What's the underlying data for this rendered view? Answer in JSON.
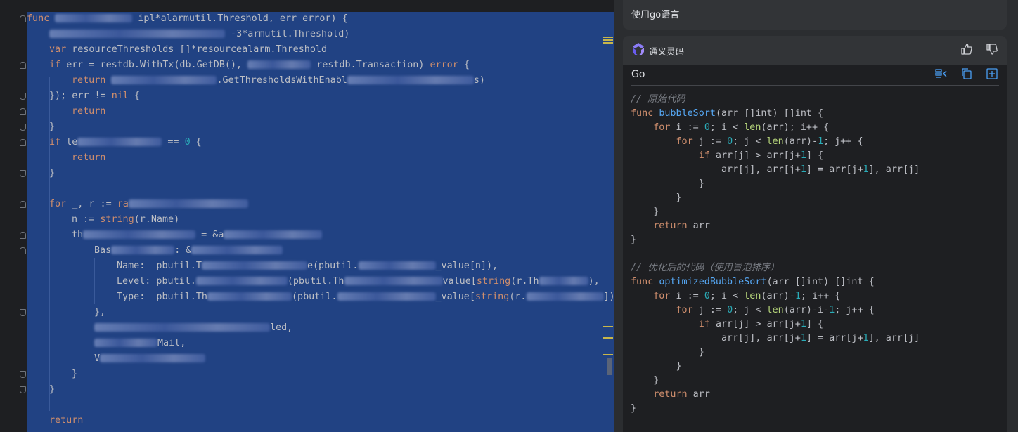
{
  "editor": {
    "lines": [
      {
        "indent": 0,
        "parts": [
          [
            "kw",
            "func "
          ],
          [
            "blur",
            ""
          ],
          [
            "t",
            " ipl*alarmutil.Threshold, err error) {"
          ]
        ]
      },
      {
        "indent": 1,
        "parts": [
          [
            "blur",
            ""
          ],
          [
            "t",
            " -3*armutil.Threshold)"
          ]
        ]
      },
      {
        "indent": 1,
        "parts": [
          [
            "kw",
            "var "
          ],
          [
            "t",
            "resourceThresholds []*resourcealarm.Threshold"
          ]
        ]
      },
      {
        "indent": 1,
        "parts": [
          [
            "kw",
            "if "
          ],
          [
            "t",
            "err = restdb.WithTx(db.GetDB(), "
          ],
          [
            "blur",
            ""
          ],
          [
            "t",
            " restdb.Transaction) "
          ],
          [
            "kw",
            "error"
          ],
          [
            "t",
            " {"
          ]
        ]
      },
      {
        "indent": 2,
        "parts": [
          [
            "kw",
            "return "
          ],
          [
            "blur",
            ""
          ],
          [
            "t",
            ".GetThresholdsWithEnabl"
          ],
          [
            "blur",
            ""
          ],
          [
            "t",
            "s)"
          ]
        ]
      },
      {
        "indent": 1,
        "parts": [
          [
            "t",
            "}); err != "
          ],
          [
            "kw",
            "nil"
          ],
          [
            "t",
            " {"
          ]
        ]
      },
      {
        "indent": 2,
        "parts": [
          [
            "kw",
            "return"
          ]
        ]
      },
      {
        "indent": 1,
        "parts": [
          [
            "t",
            "}"
          ]
        ]
      },
      {
        "indent": 1,
        "parts": [
          [
            "kw",
            "if "
          ],
          [
            "t",
            "le"
          ],
          [
            "blur",
            ""
          ],
          [
            "t",
            " == "
          ],
          [
            "num",
            "0"
          ],
          [
            "t",
            " {"
          ]
        ]
      },
      {
        "indent": 2,
        "parts": [
          [
            "kw",
            "return"
          ]
        ]
      },
      {
        "indent": 1,
        "parts": [
          [
            "t",
            "}"
          ]
        ]
      },
      {
        "indent": 1,
        "parts": [
          [
            "t",
            ""
          ]
        ]
      },
      {
        "indent": 1,
        "parts": [
          [
            "kw",
            "for "
          ],
          [
            "t",
            "_, r := "
          ],
          [
            "kw",
            "ra"
          ],
          [
            "blur",
            ""
          ]
        ]
      },
      {
        "indent": 2,
        "parts": [
          [
            "t",
            "n := "
          ],
          [
            "kw",
            "string"
          ],
          [
            "t",
            "(r.Name)"
          ]
        ]
      },
      {
        "indent": 2,
        "parts": [
          [
            "t",
            "th"
          ],
          [
            "blur",
            ""
          ],
          [
            "t",
            " = &a"
          ],
          [
            "blur",
            ""
          ]
        ]
      },
      {
        "indent": 3,
        "parts": [
          [
            "t",
            "Bas"
          ],
          [
            "blur",
            ""
          ],
          [
            "t",
            ": &"
          ],
          [
            "blur",
            ""
          ]
        ]
      },
      {
        "indent": 4,
        "parts": [
          [
            "t",
            "Name:  pbutil.T"
          ],
          [
            "blur",
            ""
          ],
          [
            "t",
            "e(pbutil."
          ],
          [
            "blur",
            ""
          ],
          [
            "t",
            "_value[n]),"
          ]
        ]
      },
      {
        "indent": 4,
        "parts": [
          [
            "t",
            "Level: pbutil."
          ],
          [
            "blur",
            ""
          ],
          [
            "t",
            "(pbutil.Th"
          ],
          [
            "blur",
            ""
          ],
          [
            "t",
            "value["
          ],
          [
            "kw",
            "string"
          ],
          [
            "t",
            "(r.Th"
          ],
          [
            "blur",
            ""
          ],
          [
            "t",
            "),"
          ]
        ]
      },
      {
        "indent": 4,
        "parts": [
          [
            "t",
            "Type:  pbutil.Th"
          ],
          [
            "blur",
            ""
          ],
          [
            "t",
            "(pbutil."
          ],
          [
            "blur",
            ""
          ],
          [
            "t",
            "_value["
          ],
          [
            "kw",
            "string"
          ],
          [
            "t",
            "(r."
          ],
          [
            "blur",
            ""
          ],
          [
            "t",
            "])),"
          ]
        ]
      },
      {
        "indent": 3,
        "parts": [
          [
            "t",
            "},"
          ]
        ]
      },
      {
        "indent": 3,
        "parts": [
          [
            "blur",
            ""
          ],
          [
            "t",
            "led,"
          ]
        ]
      },
      {
        "indent": 3,
        "parts": [
          [
            "blur",
            ""
          ],
          [
            "t",
            "Mail,"
          ]
        ]
      },
      {
        "indent": 3,
        "parts": [
          [
            "t",
            "V"
          ],
          [
            "blur",
            ""
          ]
        ]
      },
      {
        "indent": 2,
        "parts": [
          [
            "t",
            "}"
          ]
        ]
      },
      {
        "indent": 1,
        "parts": [
          [
            "t",
            "}"
          ]
        ]
      },
      {
        "indent": 1,
        "parts": [
          [
            "t",
            ""
          ]
        ]
      },
      {
        "indent": 1,
        "parts": [
          [
            "kw",
            "return"
          ]
        ]
      }
    ]
  },
  "panel": {
    "prev_message": "使用go语言",
    "assistant_name": "通义灵码",
    "code_lang": "Go",
    "code_lines": [
      "// 原始代码",
      "func bubbleSort(arr []int) []int {",
      "    for i := 0; i < len(arr); i++ {",
      "        for j := 0; j < len(arr)-1; j++ {",
      "            if arr[j] > arr[j+1] {",
      "                arr[j], arr[j+1] = arr[j+1], arr[j]",
      "            }",
      "        }",
      "    }",
      "    return arr",
      "}",
      "",
      "// 优化后的代码（使用冒泡排序）",
      "func optimizedBubbleSort(arr []int) []int {",
      "    for i := 0; i < len(arr)-1; i++ {",
      "        for j := 0; j < len(arr)-i-1; j++ {",
      "            if arr[j] > arr[j+1] {",
      "                arr[j], arr[j+1] = arr[j+1], arr[j]",
      "            }",
      "        }",
      "    }",
      "    return arr",
      "}"
    ]
  },
  "colors": {
    "selection": "#214283",
    "keyword": "#cf8e6d",
    "function": "#56a8f5",
    "number": "#2aacb8",
    "comment": "#7a7e85",
    "builtin": "#b5d47a"
  },
  "icons": [
    "thumbs-up-icon",
    "thumbs-down-icon",
    "insert-icon",
    "copy-icon",
    "new-file-icon",
    "menu-icon",
    "assistant-logo-icon"
  ]
}
